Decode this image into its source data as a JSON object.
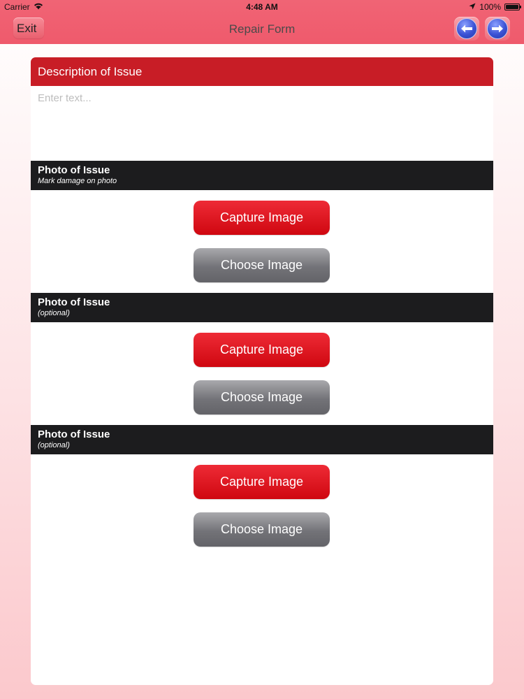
{
  "status_bar": {
    "carrier": "Carrier",
    "time": "4:48 AM",
    "battery": "100%"
  },
  "nav": {
    "title": "Repair Form",
    "exit_label": "Exit"
  },
  "description": {
    "header": "Description of Issue",
    "placeholder": "Enter text...",
    "value": ""
  },
  "photo_sections": [
    {
      "title": "Photo of Issue",
      "subtitle": "Mark damage on photo",
      "capture_label": "Capture Image",
      "choose_label": "Choose Image"
    },
    {
      "title": "Photo of Issue",
      "subtitle": "(optional)",
      "capture_label": "Capture Image",
      "choose_label": "Choose Image"
    },
    {
      "title": "Photo of Issue",
      "subtitle": "(optional)",
      "capture_label": "Capture Image",
      "choose_label": "Choose Image"
    }
  ],
  "colors": {
    "nav_bar": "#ef5a6c",
    "description_header": "#c81d26",
    "photo_header": "#1c1c1e",
    "capture_button": "#d60b14",
    "choose_button": "#6b6b70",
    "arrow_button": "#3a51d4"
  },
  "icons": [
    "wifi-icon",
    "location-arrow-icon",
    "battery-icon",
    "left-arrow-icon",
    "right-arrow-icon"
  ]
}
